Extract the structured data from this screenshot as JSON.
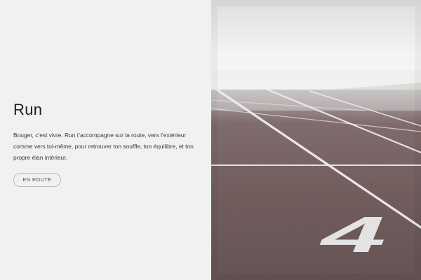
{
  "hero": {
    "title": "Run",
    "description": "Bouger, c’est vivre. Run t’accompagne sur la route, vers l’extérieur comme vers toi-même, pour retrouver ton souffle, ton équilibre, et ton propre élan intérieur.",
    "cta_label": "EN ROUTE"
  },
  "photo": {
    "lane_number": "4"
  },
  "colors": {
    "background": "#f1f1f1",
    "text": "#1f1f1f",
    "track": "#6f5a5b"
  }
}
